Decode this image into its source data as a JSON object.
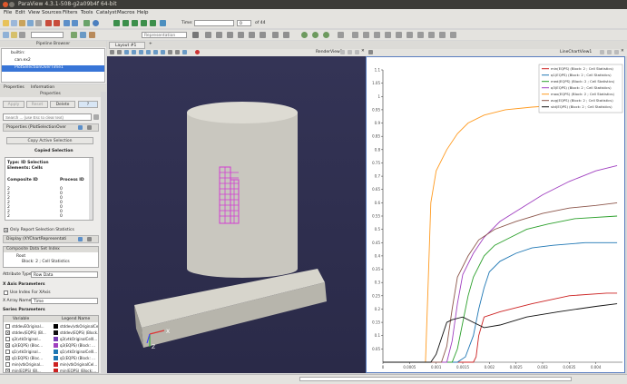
{
  "window": {
    "title": "ParaView 4.3.1-508-g2a09b4f 64-bit"
  },
  "menu": [
    "File",
    "Edit",
    "View",
    "Sources",
    "Filters",
    "Tools",
    "Catalyst",
    "Macros",
    "Help"
  ],
  "toolbar": {
    "time_label": "Time:",
    "time_value": "0",
    "time_of": "of 44",
    "representation": "Representation"
  },
  "pipeline": {
    "header": "Pipeline Browser",
    "items": [
      "builtin:",
      "can.ex2",
      "PlotSelectionOverTime1"
    ]
  },
  "tabs": {
    "properties": "Properties",
    "information": "Information"
  },
  "props": {
    "header": "Properties",
    "apply": "Apply",
    "reset": "Reset",
    "delete": "Delete",
    "help": "?",
    "search_placeholder": "Search ... (use Esc to clear text)",
    "section": "Properties (PlotSelectionOver",
    "copy_btn": "Copy Active Selection",
    "copied_label": "Copied Selection",
    "sel_type": "Type: ID Selection",
    "sel_elems": "Elements: Cells",
    "col_composite": "Composite ID",
    "col_process": "Process ID",
    "sel_rows": [
      [
        "2",
        "0"
      ],
      [
        "2",
        "0"
      ],
      [
        "2",
        "0"
      ],
      [
        "2",
        "0"
      ],
      [
        "2",
        "0"
      ],
      [
        "2",
        "0"
      ],
      [
        "2",
        "0"
      ]
    ],
    "only_report": "Only Report Selection Statistics",
    "display": "Display (XYChartRepresentati",
    "composite_header": "Composite Data Set Index",
    "tree_root": "Root",
    "tree_block": "Block: 2 ; Cell Statistics",
    "attr_label": "Attribute Type",
    "attr_value": "Row Data",
    "xaxis_header": "X Axis Parameters",
    "use_index": "Use Index For XAxis",
    "xarray_label": "X Array Name",
    "xarray_value": "Time",
    "series_header": "Series Parameters",
    "col_variable": "Variable",
    "col_legend": "Legend Name",
    "series": [
      {
        "var": "stddevEOriginal...",
        "legend": "stddev(vtkOriginalCe...",
        "checked": false,
        "color": "#000000"
      },
      {
        "var": "stddev(EQPS) (Bl...",
        "legend": "stddev(EQPS) (Block...",
        "checked": true,
        "color": "#111111"
      },
      {
        "var": "q3(vtkOriginal...",
        "legend": "q3(vtkOriginalCellI...",
        "checked": false,
        "color": "#7a3fb5"
      },
      {
        "var": "q3(EQPS) (Bloc...",
        "legend": "q3(EQPS) (Block: ...",
        "checked": true,
        "color": "#a040c0"
      },
      {
        "var": "q1(vtkOriginal...",
        "legend": "q1(vtkOriginalCellI...",
        "checked": false,
        "color": "#1f77b4"
      },
      {
        "var": "q1(EQPS) (Bloc...",
        "legend": "q1(EQPS) (Block: ...",
        "checked": true,
        "color": "#1f77b4"
      },
      {
        "var": "min(vtkOriginal...",
        "legend": "min(vtkOriginalCel...",
        "checked": false,
        "color": "#cc2222"
      },
      {
        "var": "min(EQPS) (Bl...",
        "legend": "min(EQPS) (Block:...",
        "checked": true,
        "color": "#cc2222"
      }
    ]
  },
  "layout_tab": "Layout #1",
  "render_view_label": "RenderView1",
  "chart_view_label": "LineChartView1",
  "axes": {
    "x": "X",
    "y": "Y",
    "z": "Z"
  },
  "chart_data": {
    "type": "line",
    "xlim": [
      0,
      0.0045
    ],
    "ylim": [
      0,
      1.1
    ],
    "x_ticks": [
      "0",
      "0.0005",
      "0.001",
      "0.0015",
      "0.002",
      "0.0025",
      "0.003",
      "0.0035",
      "0.004"
    ],
    "y_ticks": [
      "0.05",
      "0.1",
      "0.15",
      "0.2",
      "0.25",
      "0.3",
      "0.35",
      "0.4",
      "0.45",
      "0.5",
      "0.55",
      "0.6",
      "0.65",
      "0.7",
      "0.75",
      "0.8",
      "0.85",
      "0.9",
      "0.95",
      "1",
      "1.05",
      "1.1"
    ],
    "series": [
      {
        "name": "min(EQPS) (Block: 2 ; Cell Statistics)",
        "color": "#cc2222",
        "x": [
          0,
          0.0015,
          0.0017,
          0.00175,
          0.0018,
          0.0019,
          0.0022,
          0.0028,
          0.0035,
          0.0042,
          0.0044
        ],
        "y": [
          0,
          0,
          0,
          0.02,
          0.1,
          0.17,
          0.19,
          0.22,
          0.25,
          0.26,
          0.26
        ]
      },
      {
        "name": "q1(EQPS) (Block: 2 ; Cell Statistics)",
        "color": "#1f77b4",
        "x": [
          0,
          0.0014,
          0.00155,
          0.0017,
          0.0018,
          0.0019,
          0.002,
          0.0022,
          0.0025,
          0.0028,
          0.0032,
          0.0038,
          0.0044
        ],
        "y": [
          0,
          0,
          0.02,
          0.1,
          0.2,
          0.28,
          0.34,
          0.38,
          0.41,
          0.43,
          0.44,
          0.45,
          0.45
        ]
      },
      {
        "name": "med(EQPS) (Block: 2 ; Cell Statistics)",
        "color": "#2ca02c",
        "x": [
          0,
          0.0013,
          0.0014,
          0.0015,
          0.0016,
          0.0017,
          0.0019,
          0.0021,
          0.0024,
          0.0027,
          0.0031,
          0.0036,
          0.0044
        ],
        "y": [
          0,
          0,
          0.05,
          0.15,
          0.25,
          0.32,
          0.4,
          0.44,
          0.47,
          0.5,
          0.52,
          0.54,
          0.55
        ]
      },
      {
        "name": "q3(EQPS) (Block: 2 ; Cell Statistics)",
        "color": "#a040c0",
        "x": [
          0,
          0.0012,
          0.0013,
          0.0014,
          0.0015,
          0.0017,
          0.0019,
          0.0022,
          0.0026,
          0.003,
          0.0035,
          0.004,
          0.0044
        ],
        "y": [
          0,
          0,
          0.08,
          0.22,
          0.33,
          0.41,
          0.47,
          0.53,
          0.58,
          0.63,
          0.68,
          0.72,
          0.74
        ]
      },
      {
        "name": "max(EQPS) (Block: 2 ; Cell Statistics)",
        "color": "#ff9a1f",
        "x": [
          0,
          0.0008,
          0.00085,
          0.0009,
          0.001,
          0.0012,
          0.0014,
          0.0016,
          0.0019,
          0.0023,
          0.0028,
          0.0035,
          0.0044
        ],
        "y": [
          0,
          0,
          0.3,
          0.6,
          0.72,
          0.8,
          0.86,
          0.9,
          0.93,
          0.95,
          0.96,
          0.97,
          0.97
        ]
      },
      {
        "name": "avg(EQPS) (Block: 2 ; Cell Statistics)",
        "color": "#8c564b",
        "x": [
          0,
          0.0011,
          0.0012,
          0.0013,
          0.0014,
          0.0016,
          0.0018,
          0.0021,
          0.0025,
          0.003,
          0.0035,
          0.004,
          0.0044
        ],
        "y": [
          0,
          0,
          0.06,
          0.2,
          0.32,
          0.4,
          0.46,
          0.5,
          0.53,
          0.56,
          0.58,
          0.59,
          0.6
        ]
      },
      {
        "name": "std(EQPS) (Block: 2 ; Cell Statistics)",
        "color": "#111111",
        "x": [
          0,
          0.0009,
          0.001,
          0.0011,
          0.0012,
          0.0013,
          0.0015,
          0.0017,
          0.0019,
          0.0022,
          0.0027,
          0.0033,
          0.004,
          0.0044
        ],
        "y": [
          0,
          0,
          0.03,
          0.09,
          0.15,
          0.16,
          0.17,
          0.15,
          0.13,
          0.14,
          0.17,
          0.19,
          0.21,
          0.22
        ]
      }
    ]
  }
}
